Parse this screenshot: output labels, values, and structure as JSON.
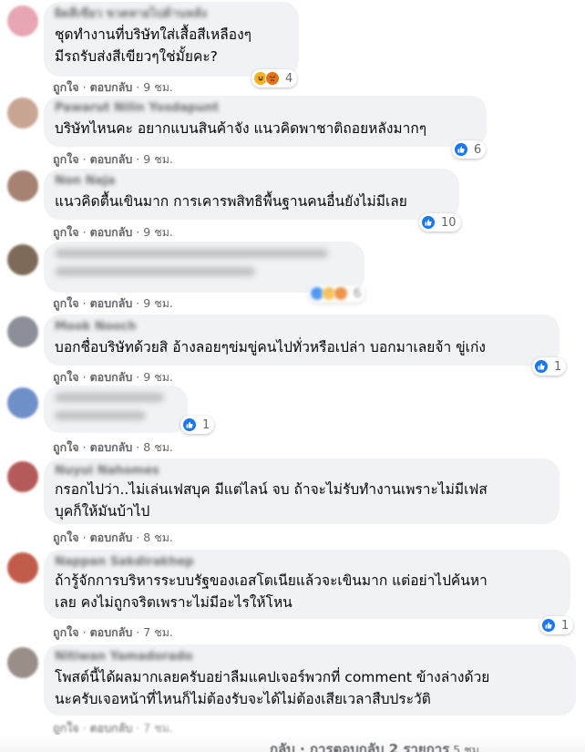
{
  "actions": {
    "like": "ถูกใจ",
    "reply": "ตอบกลับ"
  },
  "comments": [
    {
      "name": "ผิดสีเขียว ขวดหายไปด้านหลัง",
      "text": "ชุดทำงานที่บริษัทใส่เสื้อสีเหลืองๆ\nมีรถรับส่งสีเขียวๆใช่มั้ยคะ?",
      "time": "9 ชม.",
      "reactions": [
        "haha",
        "angry"
      ],
      "reaction_count": "4",
      "avatar_color": "#e8a6b4"
    },
    {
      "name": "Pawarut Nilin Yosdapunt",
      "text": "บริษัทไหนคะ อยากแบนสินค้าจัง แนวคิดพาชาติถอยหลังมากๆ",
      "time": "9 ชม.",
      "reactions": [
        "like"
      ],
      "reaction_count": "6",
      "avatar_color": "#c9a694"
    },
    {
      "name": "Non Naja",
      "text": "แนวคิดตื้นเขินมาก การเคารพสิทธิพื้นฐานคนอื่นยังไม่มีเลย",
      "time": "9 ชม.",
      "reactions": [
        "like"
      ],
      "reaction_count": "10",
      "avatar_color": "#a58272"
    },
    {
      "name": "",
      "text": "",
      "time": "9 ชม.",
      "reactions": [
        "like",
        "haha",
        "angry"
      ],
      "reaction_count": "6",
      "avatar_color": "#7d6a58"
    },
    {
      "name": "Mook Nooch",
      "text": "บอกชื่อบริษัทด้วยสิ อ้างลอยๆข่มขู่คนไปทั่วหรือเปล่า บอกมาเลยจ้า ขู่เก่ง",
      "time": "9 ชม.",
      "reactions": [
        "like"
      ],
      "reaction_count": "1",
      "avatar_color": "#8c8f9a"
    },
    {
      "name": "",
      "text": "",
      "time": "8 ชม.",
      "reactions": [
        "like"
      ],
      "reaction_count": "1",
      "avatar_color": "#6f8fc8"
    },
    {
      "name": "Nuyui Nahomes",
      "text": "กรอกไปว่า..ไม่เล่นเฟสบุค มีแต่ไลน์ จบ ถ้าจะไม่รับทำงานเพราะไม่มีเฟส\nบุคก็ให้มันบ้าไป",
      "time": "8 ชม.",
      "reactions": [],
      "reaction_count": "",
      "avatar_color": "#b55a5a"
    },
    {
      "name": "Nappan Sakdirakhep",
      "text": "ถ้ารู้จักการบริหารระบบรัฐของเอสโตเนียแล้วจะเขินมาก แต่อย่าไปค้นหา\nเลย คงไม่ถูกจริตเพราะไม่มีอะไรให้โหน",
      "time": "7 ชม.",
      "reactions": [
        "like"
      ],
      "reaction_count": "1",
      "avatar_color": "#c25c4a"
    },
    {
      "name": "Nitiwan Yamadorado",
      "text": "โพสต์นี้ได้ผลมากเลยครับอย่าลืมแคปเจอร์พวกที่ comment ข้างล่างด้วย\nนะครับเจอหน้าที่ไหนก็ไม่ต้องรับจะได้ไม่ต้องเสียเวลาสืบประวัติ",
      "time": "7 ชม.",
      "reactions": [],
      "reaction_count": "",
      "avatar_color": "#9a8f88"
    }
  ],
  "footer": {
    "more_replies": "กลับ · การตอบกลับ 2 รายการ",
    "more_replies_time": "5 ชม."
  }
}
